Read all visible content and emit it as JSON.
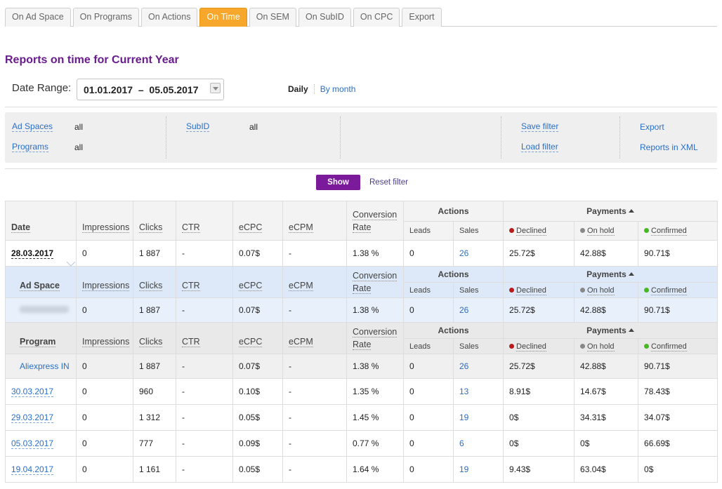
{
  "tabs": [
    {
      "label": "On Ad Space",
      "active": false
    },
    {
      "label": "On Programs",
      "active": false
    },
    {
      "label": "On Actions",
      "active": false
    },
    {
      "label": "On Time",
      "active": true
    },
    {
      "label": "On SEM",
      "active": false
    },
    {
      "label": "On SubID",
      "active": false
    },
    {
      "label": "On CPC",
      "active": false
    },
    {
      "label": "Export",
      "active": false
    }
  ],
  "title": "Reports on time for Current Year",
  "date_range": {
    "label": "Date Range:",
    "value": "01.01.2017  –  05.05.2017"
  },
  "period": {
    "daily": "Daily",
    "by_month": "By month"
  },
  "filter": {
    "ad_spaces_label": "Ad Spaces",
    "ad_spaces_value": "all",
    "programs_label": "Programs",
    "programs_value": "all",
    "subid_label": "SubID",
    "subid_value": "all",
    "save_filter": "Save filter",
    "load_filter": "Load filter",
    "export": "Export",
    "reports_xml": "Reports in XML"
  },
  "buttons": {
    "show": "Show",
    "reset": "Reset filter"
  },
  "columns": {
    "date": "Date",
    "ad_space": "Ad Space",
    "program": "Program",
    "impressions": "Impressions",
    "clicks": "Clicks",
    "ctr": "CTR",
    "ecpc": "eCPC",
    "ecpm": "eCPM",
    "conversion": "Conversion",
    "rate": "Rate",
    "actions": "Actions",
    "leads": "Leads",
    "sales": "Sales",
    "payments": "Payments",
    "declined": "Declined",
    "on_hold": "On hold",
    "confirmed": "Confirmed"
  },
  "expanded_row": {
    "date": "28.03.2017",
    "impressions": "0",
    "clicks": "1 887",
    "ctr": "-",
    "ecpc": "0.07$",
    "ecpm": "-",
    "conv": "1.38 %",
    "leads": "0",
    "sales": "26",
    "declined": "25.72$",
    "on_hold": "42.88$",
    "confirmed": "90.71$"
  },
  "ad_space_row": {
    "impressions": "0",
    "clicks": "1 887",
    "ctr": "-",
    "ecpc": "0.07$",
    "ecpm": "-",
    "conv": "1.38 %",
    "leads": "0",
    "sales": "26",
    "declined": "25.72$",
    "on_hold": "42.88$",
    "confirmed": "90.71$"
  },
  "program_row": {
    "name": "Aliexpress IN",
    "impressions": "0",
    "clicks": "1 887",
    "ctr": "-",
    "ecpc": "0.07$",
    "ecpm": "-",
    "conv": "1.38 %",
    "leads": "0",
    "sales": "26",
    "declined": "25.72$",
    "on_hold": "42.88$",
    "confirmed": "90.71$"
  },
  "rows": [
    {
      "date": "30.03.2017",
      "impressions": "0",
      "clicks": "960",
      "ctr": "-",
      "ecpc": "0.10$",
      "ecpm": "-",
      "conv": "1.35 %",
      "leads": "0",
      "sales": "13",
      "declined": "8.91$",
      "on_hold": "14.67$",
      "confirmed": "78.43$"
    },
    {
      "date": "29.03.2017",
      "impressions": "0",
      "clicks": "1 312",
      "ctr": "-",
      "ecpc": "0.05$",
      "ecpm": "-",
      "conv": "1.45 %",
      "leads": "0",
      "sales": "19",
      "declined": "0$",
      "on_hold": "34.31$",
      "confirmed": "34.07$"
    },
    {
      "date": "05.03.2017",
      "impressions": "0",
      "clicks": "777",
      "ctr": "-",
      "ecpc": "0.09$",
      "ecpm": "-",
      "conv": "0.77 %",
      "leads": "0",
      "sales": "6",
      "declined": "0$",
      "on_hold": "0$",
      "confirmed": "66.69$"
    },
    {
      "date": "19.04.2017",
      "impressions": "0",
      "clicks": "1 161",
      "ctr": "-",
      "ecpc": "0.05$",
      "ecpm": "-",
      "conv": "1.64 %",
      "leads": "0",
      "sales": "19",
      "declined": "9.43$",
      "on_hold": "63.04$",
      "confirmed": "0$"
    }
  ]
}
